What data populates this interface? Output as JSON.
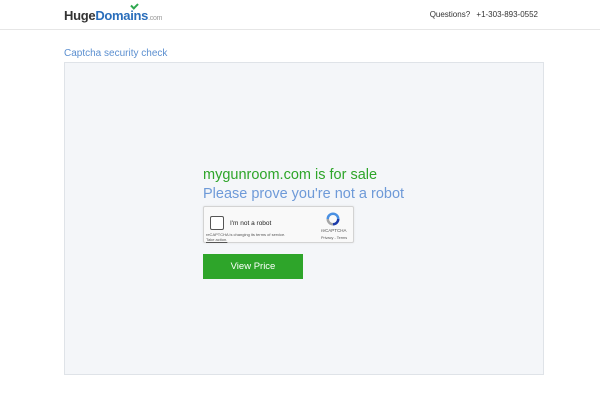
{
  "header": {
    "logo": {
      "huge": "Huge",
      "domains": "Domains",
      "com": ".com"
    },
    "questions_label": "Questions?",
    "phone": "+1-303-893-0552"
  },
  "main": {
    "section_title": "Captcha security check",
    "sale_heading": "mygunroom.com is for sale",
    "prove_heading": "Please prove you're not a robot",
    "recaptcha": {
      "label": "I'm not a robot",
      "notice_line1": "reCAPTCHA is changing its terms of service.",
      "notice_link": "Take action.",
      "brand": "reCAPTCHA",
      "terms": "Privacy - Terms"
    },
    "view_price_label": "View Price"
  },
  "colors": {
    "accent_green": "#2ea52a",
    "link_blue": "#5b8fd0",
    "brand_blue": "#2a6ebb"
  }
}
